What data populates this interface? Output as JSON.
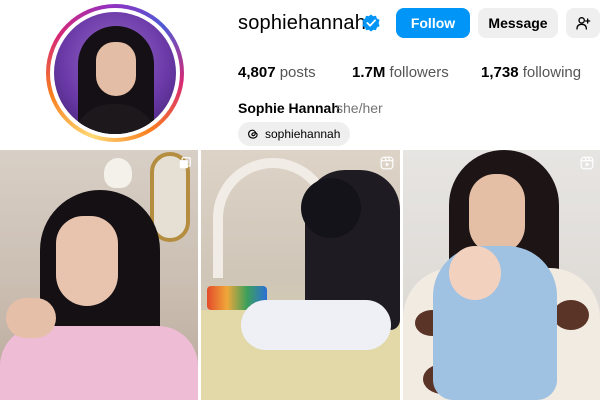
{
  "profile": {
    "username": "sophiehannah",
    "full_name": "Sophie Hannah",
    "pronouns": "she/her",
    "verified": true
  },
  "actions": {
    "follow_label": "Follow",
    "message_label": "Message",
    "add_user_icon": "add-user-icon"
  },
  "stats": {
    "posts_count": "4,807",
    "posts_label": "posts",
    "followers_count": "1.7M",
    "followers_label": "followers",
    "following_count": "1,738",
    "following_label": "following"
  },
  "threads": {
    "handle": "sophiehannah",
    "icon": "threads-icon"
  },
  "grid": {
    "posts": [
      {
        "type": "post",
        "icon": "multiple-media-icon"
      },
      {
        "type": "reel",
        "icon": "reel-icon"
      },
      {
        "type": "reel",
        "icon": "reel-icon"
      }
    ]
  },
  "colors": {
    "follow_button": "#0095f6",
    "secondary_button": "#efefef",
    "verified_badge": "#0095f6"
  }
}
